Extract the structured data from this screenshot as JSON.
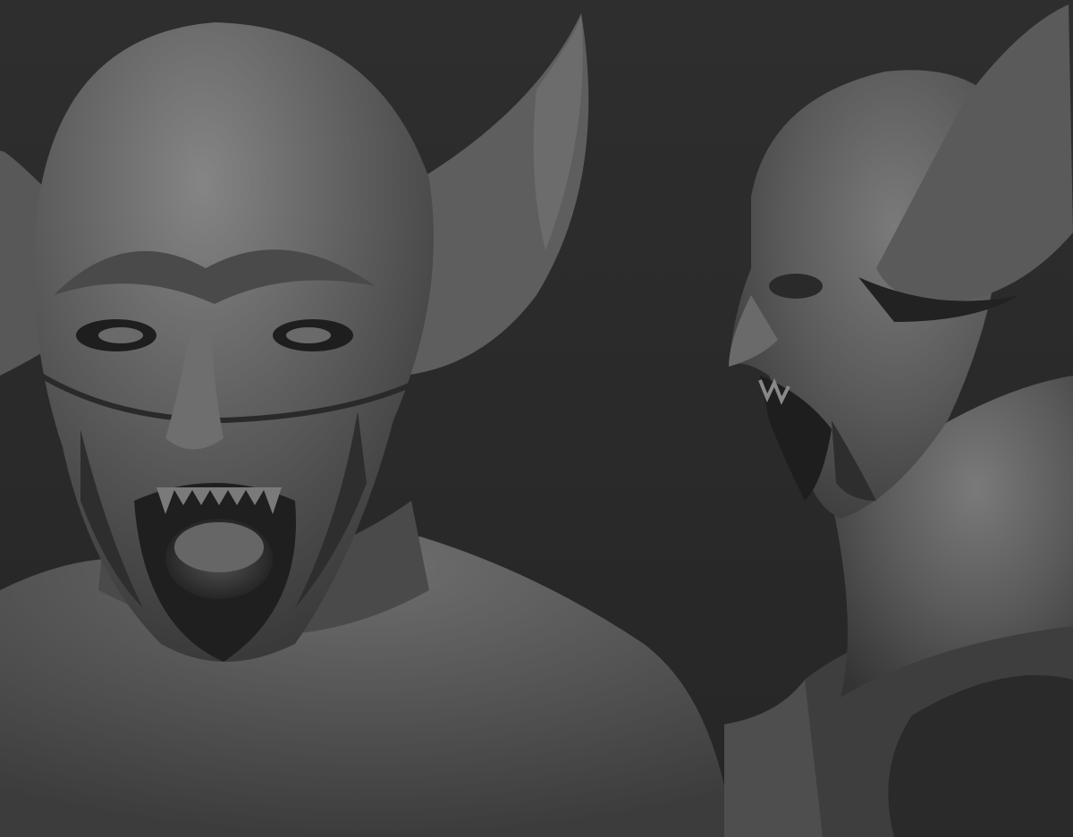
{
  "scene": {
    "background_color": "#2c2c2c",
    "clay_color": "#6a6a6a",
    "shadow_color": "#1a1a1a",
    "highlight_color": "#8a8a8a",
    "views": [
      {
        "id": "front",
        "subject": "sculpted-head-front-view"
      },
      {
        "id": "side",
        "subject": "sculpted-head-side-view"
      }
    ]
  }
}
